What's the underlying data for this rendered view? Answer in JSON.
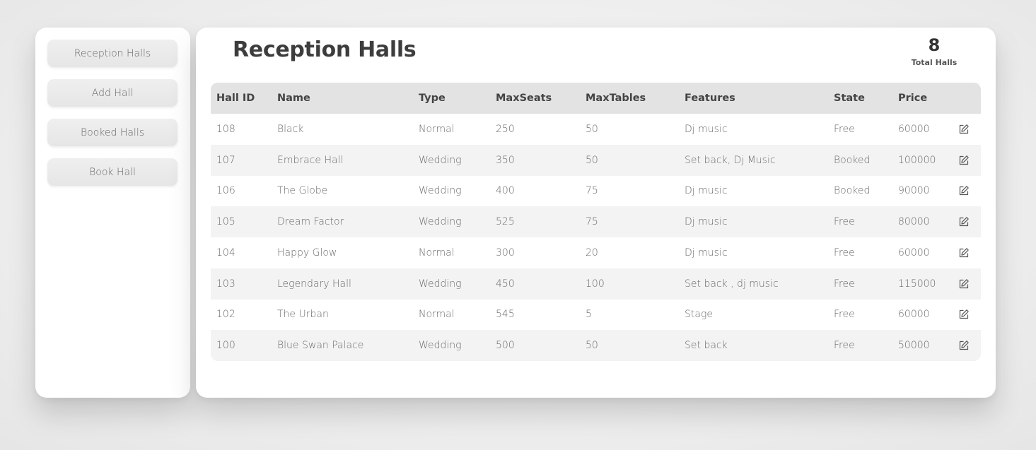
{
  "sidebar": {
    "items": [
      {
        "label": "Reception Halls"
      },
      {
        "label": "Add Hall"
      },
      {
        "label": "Booked Halls"
      },
      {
        "label": "Book Hall"
      }
    ]
  },
  "main": {
    "title": "Reception Halls",
    "total": {
      "count": "8",
      "label": "Total Halls"
    }
  },
  "table": {
    "columns": [
      "Hall ID",
      "Name",
      "Type",
      "MaxSeats",
      "MaxTables",
      "Features",
      "State",
      "Price"
    ],
    "rows": [
      [
        "108",
        "Black",
        "Normal",
        "250",
        "50",
        "Dj music",
        "Free",
        "60000"
      ],
      [
        "107",
        "Embrace Hall",
        "Wedding",
        "350",
        "50",
        "Set back, Dj Music",
        "Booked",
        "100000"
      ],
      [
        "106",
        "The Globe",
        "Wedding",
        "400",
        "75",
        "Dj music",
        "Booked",
        "90000"
      ],
      [
        "105",
        "Dream Factor",
        "Wedding",
        "525",
        "75",
        "Dj music",
        "Free",
        "80000"
      ],
      [
        "104",
        "Happy Glow",
        "Normal",
        "300",
        "20",
        "Dj music",
        "Free",
        "60000"
      ],
      [
        "103",
        "Legendary Hall",
        "Wedding",
        "450",
        "100",
        "Set back , dj music",
        "Free",
        "115000"
      ],
      [
        "102",
        "The Urban",
        "Normal",
        "545",
        "5",
        "Stage",
        "Free",
        "60000"
      ],
      [
        "100",
        "Blue Swan Palace",
        "Wedding",
        "500",
        "50",
        "Set back",
        "Free",
        "50000"
      ]
    ],
    "row_action_icon": "edit-icon"
  }
}
